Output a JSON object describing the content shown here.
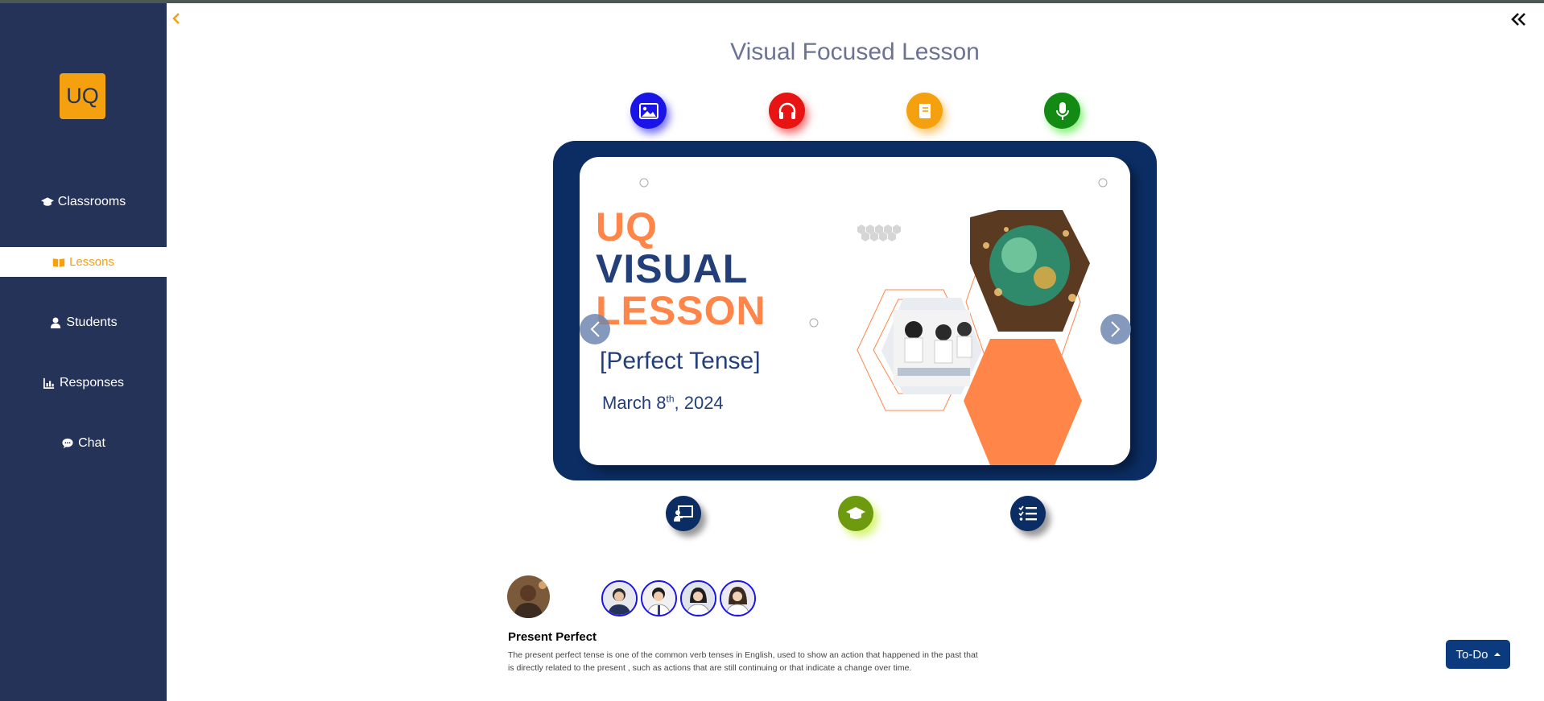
{
  "sidebar": {
    "logo": "UQ",
    "items": [
      {
        "label": "Classrooms",
        "icon": "graduation-cap-icon"
      },
      {
        "label": "Lessons",
        "icon": "book-open-icon"
      },
      {
        "label": "Students",
        "icon": "user-icon"
      },
      {
        "label": "Responses",
        "icon": "bar-chart-icon"
      },
      {
        "label": "Chat",
        "icon": "chat-bubble-icon"
      }
    ],
    "active": "Lessons"
  },
  "header": {
    "title": "Visual Focused Lesson",
    "back_icon": "chevron-left-icon",
    "collapse_icon": "double-chevron-left-icon"
  },
  "modes": [
    {
      "name": "image-icon",
      "color": "#1a14e6"
    },
    {
      "name": "headphones-icon",
      "color": "#e81414"
    },
    {
      "name": "book-icon",
      "color": "#f5a10f"
    },
    {
      "name": "microphone-icon",
      "color": "#138a13"
    }
  ],
  "slide": {
    "title_line1": "UQ",
    "title_line2": "VISUAL",
    "title_line3": "LESSON",
    "topic": "[Perfect Tense]",
    "date_prefix": "March 8",
    "date_sup": "th",
    "date_suffix": ", 2024",
    "accent": "#ff8548",
    "navy": "#233f79"
  },
  "tools": [
    {
      "name": "presentation-icon",
      "color": "#0b2d63"
    },
    {
      "name": "graduation-cap-icon",
      "color": "#6d9a0f"
    },
    {
      "name": "checklist-icon",
      "color": "#0b2d63"
    }
  ],
  "lesson": {
    "name": "Present Perfect",
    "description": "The present perfect tense is one of the common verb tenses in English, used to show an action that happened in the past that is directly related to the present , such as actions that are still continuing or that indicate a change over time."
  },
  "todo": {
    "label": "To-Do"
  }
}
